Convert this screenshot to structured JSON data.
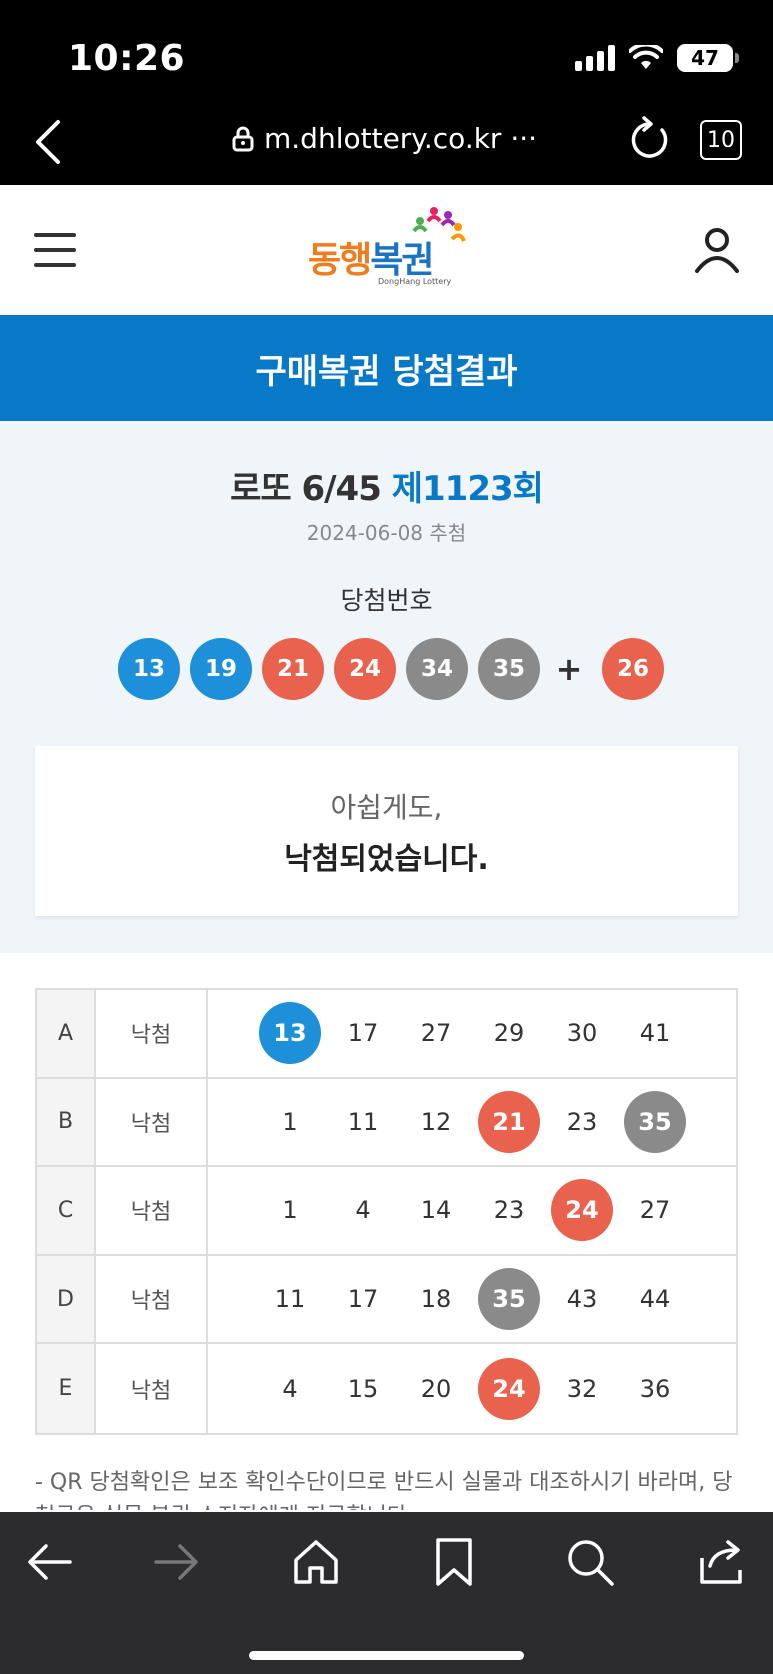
{
  "status_bar": {
    "time": "10:26",
    "battery": "47"
  },
  "browser": {
    "url": "m.dhlottery.co.kr ···",
    "tab_count": "10"
  },
  "header": {
    "logo_text_1": "동행",
    "logo_text_2": "복권",
    "logo_sub": "DongHang Lottery"
  },
  "banner": {
    "title": "구매복권 당첨결과"
  },
  "draw": {
    "game": "로또 6/45",
    "round": "제1123회",
    "date": "2024-06-08 추첨",
    "winning_label": "당첨번호",
    "numbers": [
      "13",
      "19",
      "21",
      "24",
      "34",
      "35"
    ],
    "plus": "+",
    "bonus": "26"
  },
  "result": {
    "line1": "아쉽게도,",
    "line2": "낙첨되었습니다."
  },
  "tickets": [
    {
      "label": "A",
      "status": "낙첨",
      "nums": [
        "13",
        "17",
        "27",
        "29",
        "30",
        "41"
      ]
    },
    {
      "label": "B",
      "status": "낙첨",
      "nums": [
        "1",
        "11",
        "12",
        "21",
        "23",
        "35"
      ]
    },
    {
      "label": "C",
      "status": "낙첨",
      "nums": [
        "1",
        "4",
        "14",
        "23",
        "24",
        "27"
      ]
    },
    {
      "label": "D",
      "status": "낙첨",
      "nums": [
        "11",
        "17",
        "18",
        "35",
        "43",
        "44"
      ]
    },
    {
      "label": "E",
      "status": "낙첨",
      "nums": [
        "4",
        "15",
        "20",
        "24",
        "32",
        "36"
      ]
    }
  ],
  "notice": "- QR 당첨확인은 보조 확인수단이므로 반드시 실물과 대조하시기 바라며, 당첨금은 실물 복권 소지자에게 지급합니다.",
  "colors": {
    "blue": "#1e8fd9",
    "red": "#e8624e",
    "gray": "#8a8a8a",
    "accent": "#0879c7"
  }
}
